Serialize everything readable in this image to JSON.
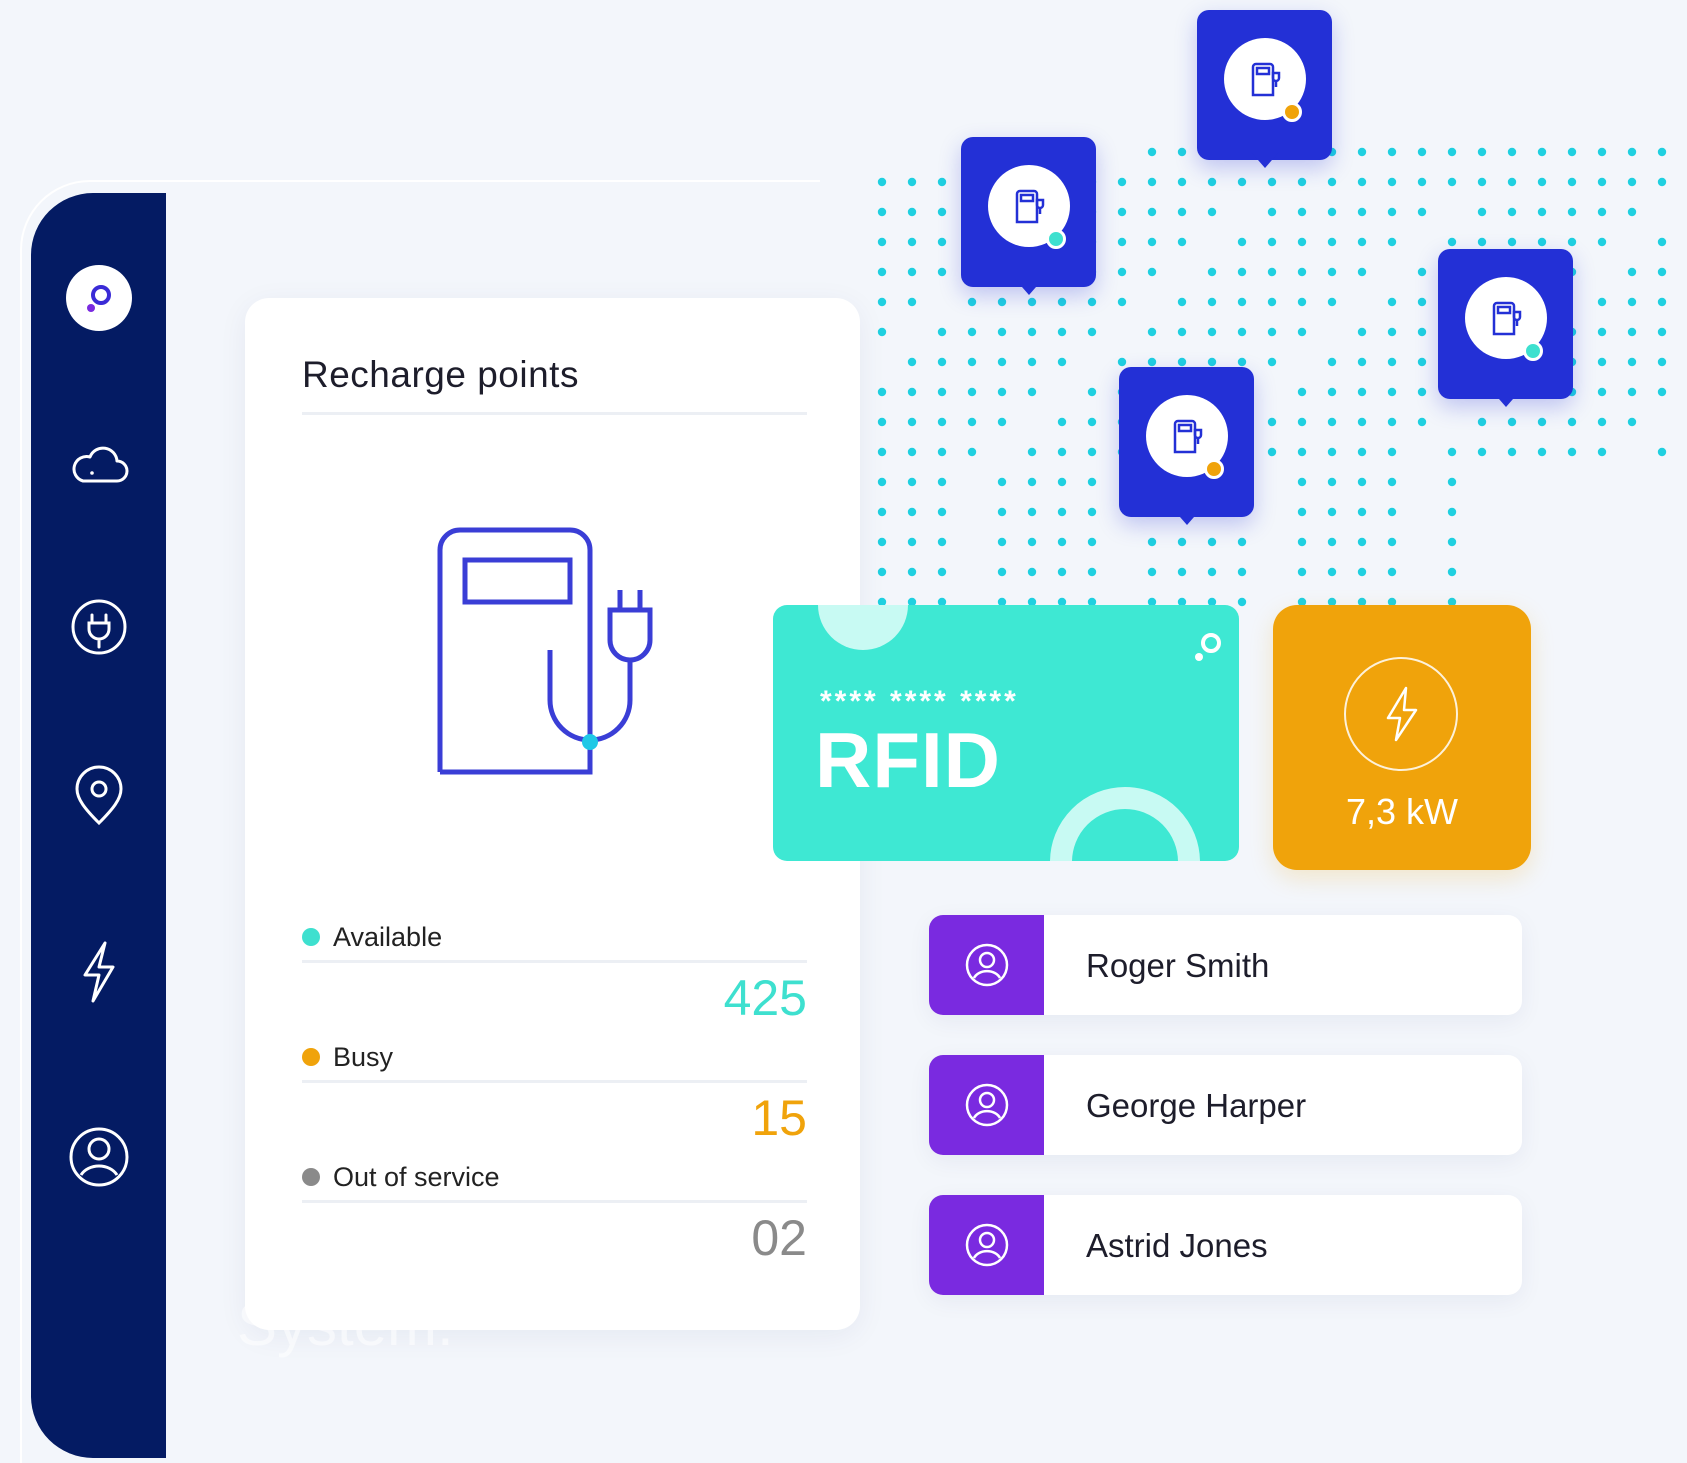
{
  "sidebar": {
    "items": [
      {
        "icon": "logo-icon"
      },
      {
        "icon": "cloud-icon"
      },
      {
        "icon": "plug-icon"
      },
      {
        "icon": "location-pin-icon"
      },
      {
        "icon": "lightning-icon"
      },
      {
        "icon": "user-icon"
      }
    ]
  },
  "recharge": {
    "title": "Recharge points",
    "stats": [
      {
        "label": "Available",
        "value": "425",
        "color": "#3ee0cf"
      },
      {
        "label": "Busy",
        "value": "15",
        "color": "#f0a30b"
      },
      {
        "label": "Out of service",
        "value": "02",
        "color": "#8a8a8a"
      }
    ]
  },
  "map": {
    "pins": [
      {
        "icon": "charger-icon",
        "status_color": "#f0a30b"
      },
      {
        "icon": "charger-icon",
        "status_color": "#3ee0cf"
      },
      {
        "icon": "charger-icon",
        "status_color": "#3ee0cf"
      },
      {
        "icon": "charger-icon",
        "status_color": "#f0a30b"
      }
    ]
  },
  "rfid_card": {
    "masked_number": "**** **** ****",
    "label": "RFID"
  },
  "power": {
    "value": "7,3 kW"
  },
  "users": [
    {
      "name": "Roger Smith"
    },
    {
      "name": "George Harper"
    },
    {
      "name": "Astrid Jones"
    }
  ],
  "background_text": "System.",
  "colors": {
    "sidebar": "#041b63",
    "pin": "#2330d6",
    "teal": "#3ee8d3",
    "orange": "#f0a30b",
    "purple": "#7a2ae0"
  }
}
